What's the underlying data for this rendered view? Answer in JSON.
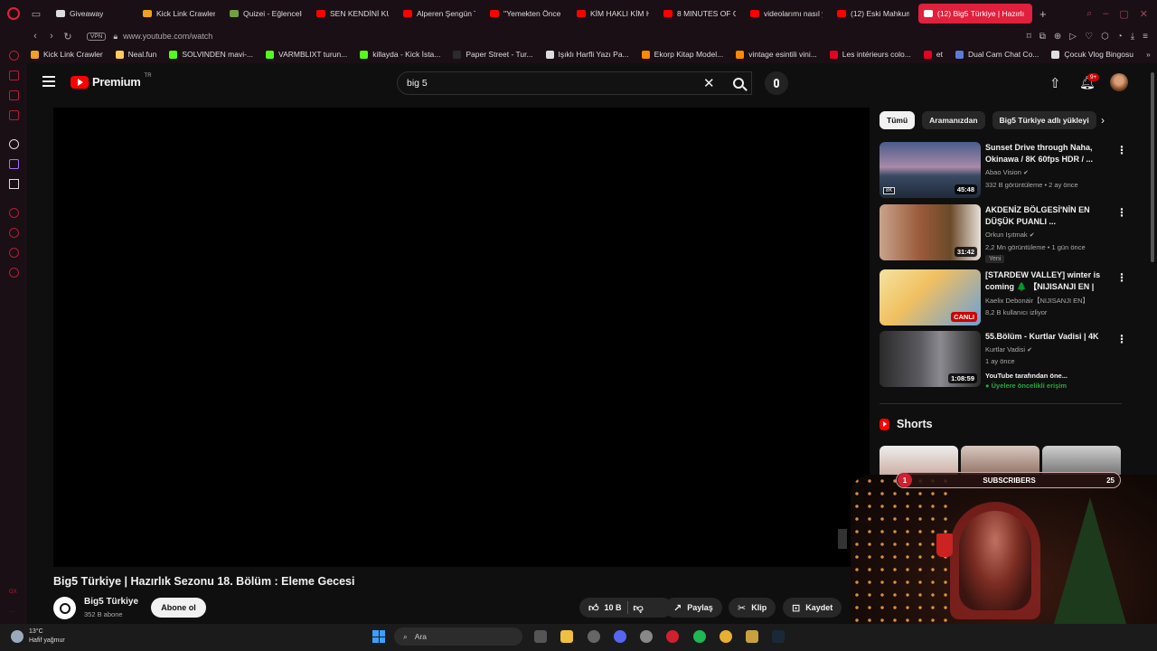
{
  "browser": {
    "tabs": [
      {
        "label": "Giveaway",
        "color": "#dddddd"
      },
      {
        "label": "Kick Link Crawler",
        "color": "#f0a020"
      },
      {
        "label": "Quizei - Eğlenceli",
        "color": "#70a040"
      },
      {
        "label": "SEN KENDİNİ KU",
        "color": "#ff0000"
      },
      {
        "label": "Alperen Şengün T",
        "color": "#ff0000"
      },
      {
        "label": "''Yemekten Önce",
        "color": "#ff0000"
      },
      {
        "label": "KİM HAKLI KİM H",
        "color": "#ff0000"
      },
      {
        "label": "8 MINUTES OF G",
        "color": "#ff0000"
      },
      {
        "label": "videolarımı nasıl y",
        "color": "#ff0000"
      },
      {
        "label": "(12) Eski Mahkum",
        "color": "#ff0000"
      },
      {
        "label": "(12) Big5 Türkiye | Hazırlı",
        "color": "#ffffff",
        "active": true
      }
    ],
    "url": "www.youtube.com/watch",
    "vpn_label": "VPN",
    "bookmarks": [
      {
        "label": "Kick Link Crawler",
        "color": "#f0a020"
      },
      {
        "label": "Neal.fun",
        "color": "#ffcc55"
      },
      {
        "label": "SOLVINDEN mavi-...",
        "color": "#53fc18"
      },
      {
        "label": "VARMBLIXT turun...",
        "color": "#53fc18"
      },
      {
        "label": "killayda - Kick İsta...",
        "color": "#53fc18"
      },
      {
        "label": "Paper Street - Tur...",
        "color": "#2b2b2b"
      },
      {
        "label": "Işıklı Harfli Yazı Pa...",
        "color": "#dddddd"
      },
      {
        "label": "Ekorp Kitap Model...",
        "color": "#ff8800"
      },
      {
        "label": "vintage esintili vini...",
        "color": "#ff8800"
      },
      {
        "label": "Les intérieurs colo...",
        "color": "#e60023"
      },
      {
        "label": "et",
        "color": "#e60023"
      },
      {
        "label": "Dual Cam Chat Co...",
        "color": "#5b7bd5"
      },
      {
        "label": "Çocuk Vlog Bingosu",
        "color": "#dddddd"
      }
    ]
  },
  "youtube": {
    "brand": "Premium",
    "region": "TR",
    "search_value": "big 5",
    "notification_count": "9+",
    "video": {
      "title": "Big5 Türkiye | Hazırlık Sezonu 18. Bölüm : Eleme Gecesi",
      "channel": "Big5 Türkiye",
      "subscribers": "352 B abone",
      "subscribe_label": "Abone ol",
      "likes": "10 B",
      "share_label": "Paylaş",
      "clip_label": "Klip",
      "save_label": "Kaydet"
    },
    "chips": [
      "Tümü",
      "Aramanızdan",
      "Big5 Türkiye adlı yükleyi"
    ],
    "recommendations": [
      {
        "title": "Sunset Drive through Naha, Okinawa / 8K 60fps HDR / ...",
        "channel": "Abao Vision",
        "verified": true,
        "meta": "332 B görüntüleme • 2 ay önce",
        "duration": "45:48",
        "badge": "8K",
        "thumb": "linear-gradient(180deg,#4a5d8a 0%,#a98aa8 45%,#3b4a62 60%,#1f2a3a 100%)"
      },
      {
        "title": "AKDENİZ BÖLGESİ'NİN EN DÜŞÜK PUANLI ...",
        "channel": "Orkun Işıtmak",
        "verified": true,
        "meta": "2,2 Mn görüntüleme • 1 gün önce",
        "duration": "31:42",
        "tag": "Yeni",
        "thumb": "linear-gradient(90deg,#c9a38a 0%,#9a5a3a 40%,#6b4a2a 70%,#e8e0d8 100%)"
      },
      {
        "title": "[STARDEW VALLEY] winter is coming 🌲 【NIJISANJI EN | ...",
        "channel": "Kaelix Debonair【NIJISANJI EN】",
        "verified": false,
        "meta": "8,2 B kullanıcı izliyor",
        "live_label": "CANLI",
        "thumb": "linear-gradient(135deg,#f6e2a0 0%,#f0c060 40%,#6aa0d8 100%)"
      },
      {
        "title": "55.Bölüm - Kurtlar Vadisi | 4K",
        "channel": "Kurtlar Vadisi",
        "verified": true,
        "meta": "1 ay önce",
        "duration": "1:08:59",
        "extra1": "YouTube tarafından öne...",
        "extra2": "Üyelere öncelikli erişim",
        "thumb": "linear-gradient(90deg,#2a2a2a 0%,#5a5a60 40%,#8a8a90 60%,#2a2a2a 100%)"
      }
    ],
    "shorts_title": "Shorts",
    "subscriber_overlay": {
      "left": "1",
      "label": "SUBSCRIBERS",
      "right": "25"
    }
  },
  "taskbar": {
    "weather_temp": "13°C",
    "weather_desc": "Hafif yağmur",
    "search_placeholder": "Ara"
  }
}
